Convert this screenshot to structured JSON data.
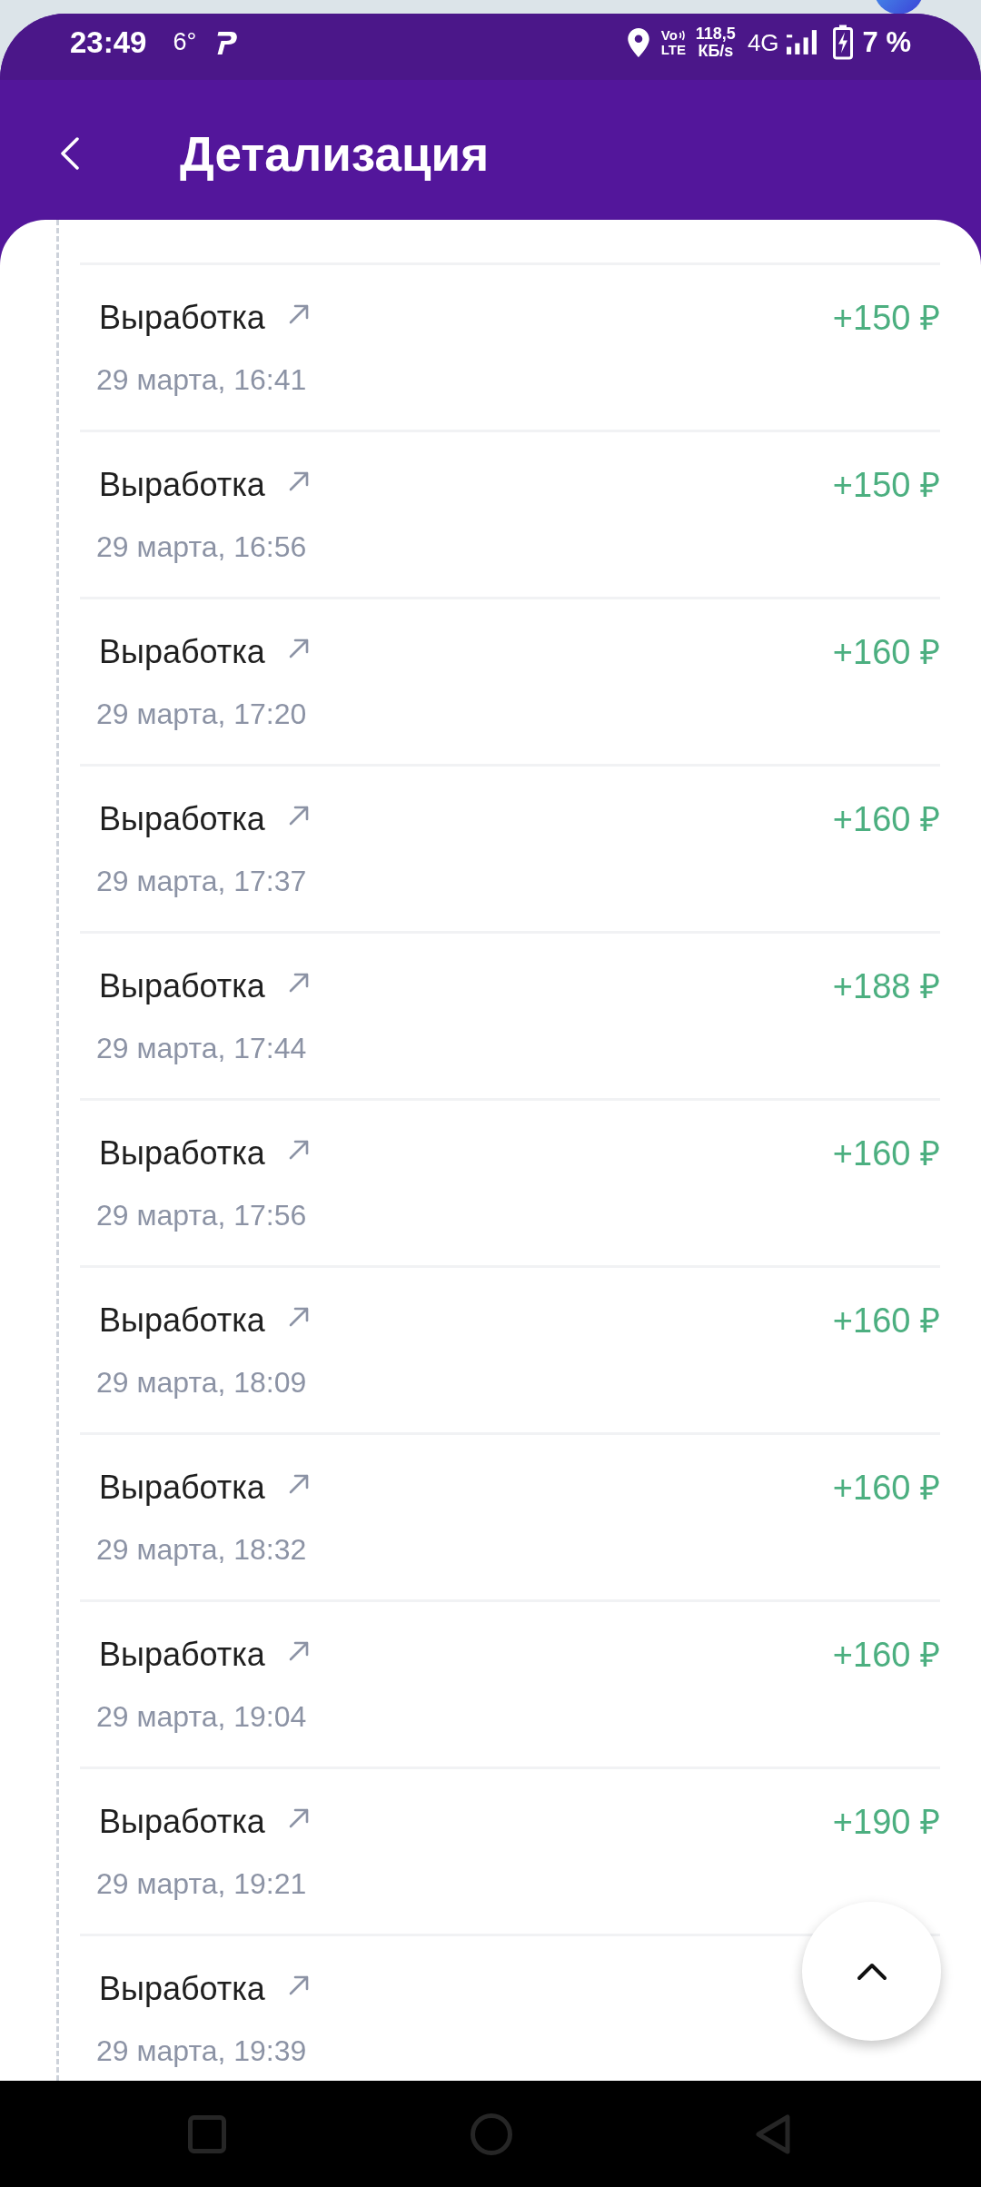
{
  "status_bar": {
    "time": "23:49",
    "temperature": "6°",
    "volte_top": "Vo",
    "volte_bottom": "LTE",
    "speed_value": "118,5",
    "speed_unit": "КБ/s",
    "network": "4G",
    "battery": "7 %"
  },
  "header": {
    "title": "Детализация"
  },
  "transactions": [
    {
      "title": "Выработка",
      "date": "29 марта, 16:41",
      "amount": "+150 ₽"
    },
    {
      "title": "Выработка",
      "date": "29 марта, 16:56",
      "amount": "+150 ₽"
    },
    {
      "title": "Выработка",
      "date": "29 марта, 17:20",
      "amount": "+160 ₽"
    },
    {
      "title": "Выработка",
      "date": "29 марта, 17:37",
      "amount": "+160 ₽"
    },
    {
      "title": "Выработка",
      "date": "29 марта, 17:44",
      "amount": "+188 ₽"
    },
    {
      "title": "Выработка",
      "date": "29 марта, 17:56",
      "amount": "+160 ₽"
    },
    {
      "title": "Выработка",
      "date": "29 марта, 18:09",
      "amount": "+160 ₽"
    },
    {
      "title": "Выработка",
      "date": "29 марта, 18:32",
      "amount": "+160 ₽"
    },
    {
      "title": "Выработка",
      "date": "29 марта, 19:04",
      "amount": "+160 ₽"
    },
    {
      "title": "Выработка",
      "date": "29 марта, 19:21",
      "amount": "+190 ₽"
    },
    {
      "title": "Выработка",
      "date": "29 марта, 19:39"
    }
  ]
}
